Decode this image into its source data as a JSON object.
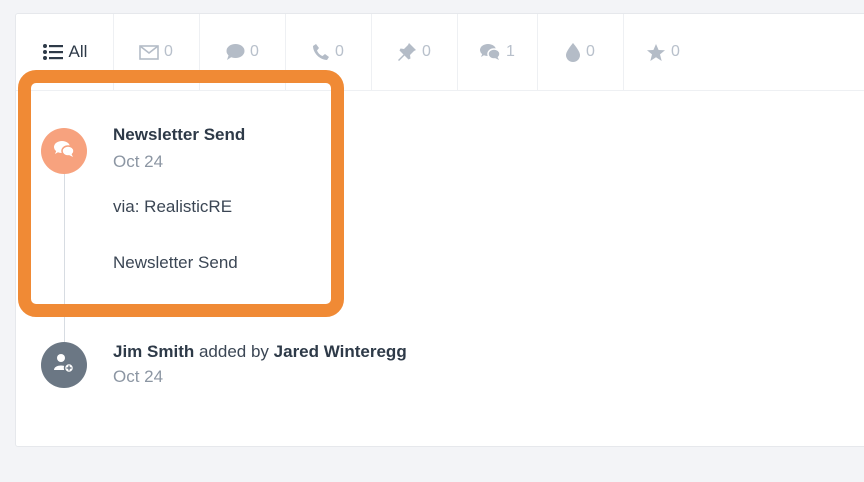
{
  "tabs": [
    {
      "key": "all",
      "icon": "list-icon",
      "label": "All"
    },
    {
      "key": "email",
      "icon": "envelope-icon",
      "count": "0"
    },
    {
      "key": "comment",
      "icon": "comment-icon",
      "count": "0"
    },
    {
      "key": "phone",
      "icon": "phone-icon",
      "count": "0"
    },
    {
      "key": "pin",
      "icon": "pushpin-icon",
      "count": "0"
    },
    {
      "key": "chats",
      "icon": "chats-icon",
      "count": "1"
    },
    {
      "key": "drop",
      "icon": "drop-icon",
      "count": "0"
    },
    {
      "key": "star",
      "icon": "star-icon",
      "count": "0"
    }
  ],
  "events": [
    {
      "title": "Newsletter Send",
      "date": "Oct 24",
      "via": "via: RealisticRE",
      "body": "Newsletter Send",
      "icon": "chats-icon",
      "color": "#f7a27e"
    },
    {
      "name": "Jim Smith",
      "action": " added by ",
      "actor": "Jared Winteregg",
      "date": "Oct 24",
      "icon": "add-user-icon",
      "color": "#6b7784"
    }
  ],
  "colors": {
    "highlight": "#f08a35",
    "text_dark": "#2e3a48",
    "text_muted": "#8c96a3"
  }
}
